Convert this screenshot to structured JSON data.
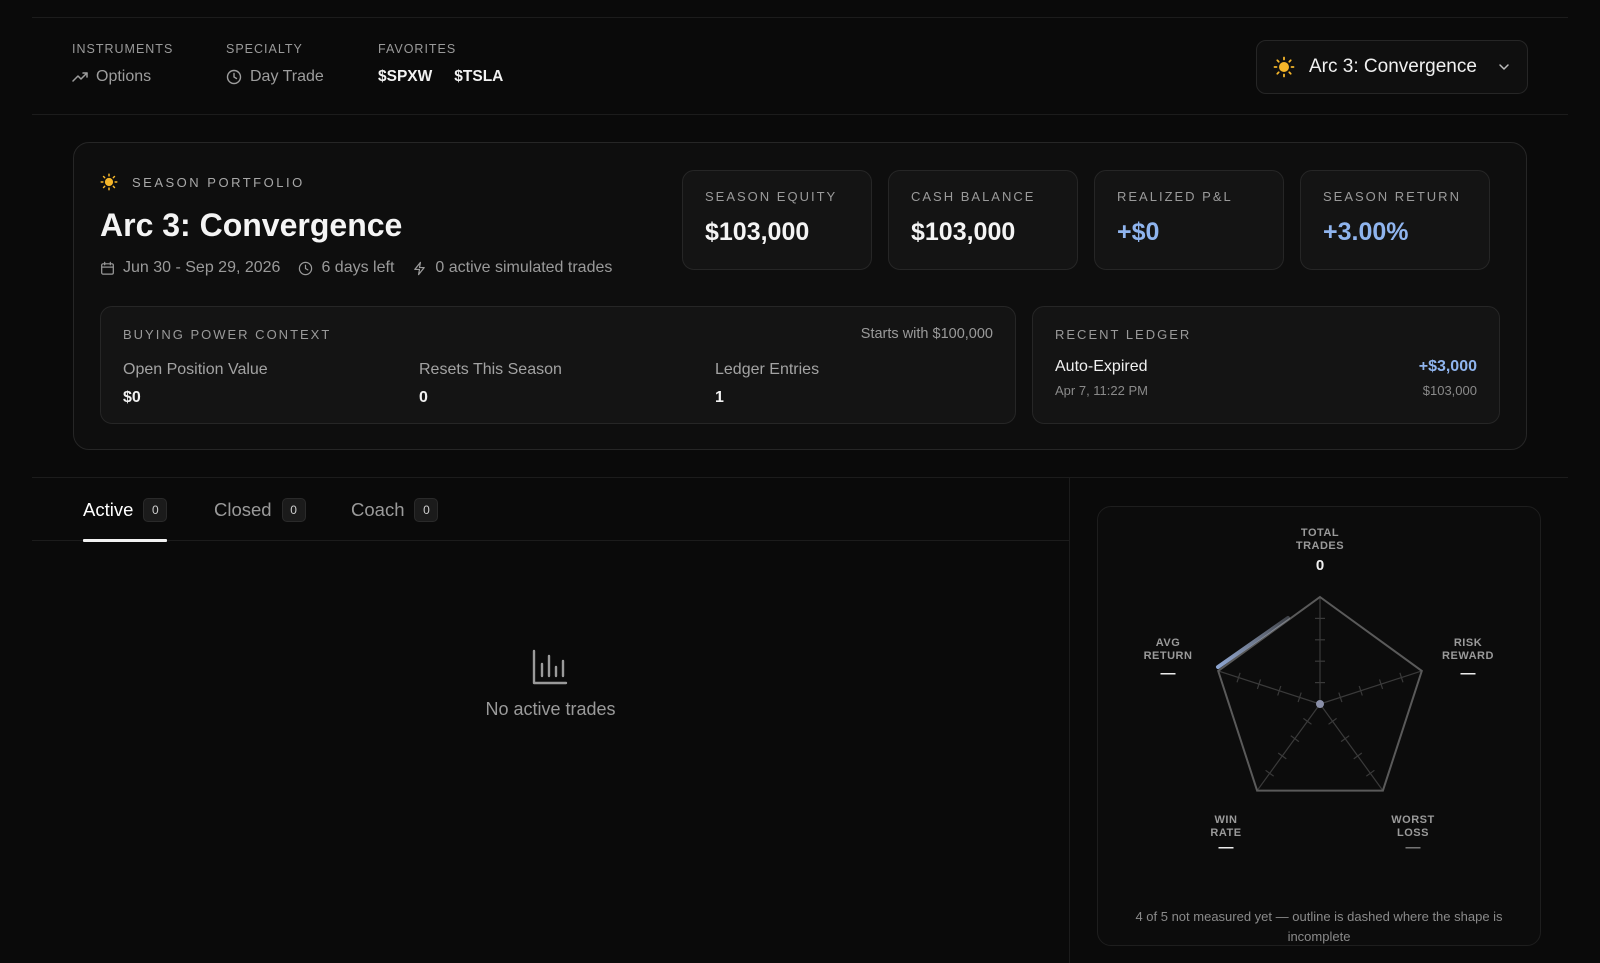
{
  "header": {
    "instruments": {
      "label": "INSTRUMENTS",
      "value": "Options",
      "icon": "trending-up-icon"
    },
    "specialty": {
      "label": "SPECIALTY",
      "value": "Day Trade",
      "icon": "clock-icon"
    },
    "favorites": {
      "label": "FAVORITES",
      "tickers": [
        "$SPXW",
        "$TSLA"
      ]
    },
    "season_selector": {
      "value": "Arc 3: Convergence",
      "icon": "sun-icon"
    }
  },
  "portfolio": {
    "eyebrow": "SEASON PORTFOLIO",
    "title": "Arc 3: Convergence",
    "dates": "Jun 30 - Sep 29, 2026",
    "days_left": "6 days left",
    "active_trades": "0 active simulated trades",
    "stats": [
      {
        "label": "SEASON EQUITY",
        "value": "$103,000",
        "accent": false
      },
      {
        "label": "CASH BALANCE",
        "value": "$103,000",
        "accent": false
      },
      {
        "label": "REALIZED P&L",
        "value": "+$0",
        "accent": true
      },
      {
        "label": "SEASON RETURN",
        "value": "+3.00%",
        "accent": true
      }
    ],
    "buying_power": {
      "label": "BUYING POWER CONTEXT",
      "starts_with": "Starts with $100,000",
      "columns": [
        {
          "label": "Open Position Value",
          "value": "$0"
        },
        {
          "label": "Resets This Season",
          "value": "0"
        },
        {
          "label": "Ledger Entries",
          "value": "1"
        }
      ]
    },
    "ledger": {
      "label": "RECENT LEDGER",
      "entry": {
        "name": "Auto-Expired",
        "date": "Apr 7, 11:22 PM",
        "amount": "+$3,000",
        "balance": "$103,000"
      }
    }
  },
  "tabs": [
    {
      "label": "Active",
      "count": "0",
      "active": true
    },
    {
      "label": "Closed",
      "count": "0",
      "active": false
    },
    {
      "label": "Coach",
      "count": "0",
      "active": false
    }
  ],
  "empty_state": {
    "text": "No active trades",
    "icon": "bar-chart-icon"
  },
  "radar": {
    "axes": [
      {
        "label_lines": [
          "TOTAL",
          "TRADES"
        ],
        "value": "0"
      },
      {
        "label_lines": [
          "RISK",
          "REWARD"
        ],
        "value": "—"
      },
      {
        "label_lines": [
          "WORST",
          "LOSS"
        ],
        "value": "—"
      },
      {
        "label_lines": [
          "WIN",
          "RATE"
        ],
        "value": "—"
      },
      {
        "label_lines": [
          "AVG",
          "RETURN"
        ],
        "value": "—"
      }
    ],
    "note": "4 of 5 not measured yet — outline is dashed where the shape is incomplete"
  },
  "colors": {
    "accent": "#8fb4ee",
    "background": "#0a0a0a",
    "card": "#141414",
    "border": "#262626",
    "sun": "#f5b62a"
  }
}
